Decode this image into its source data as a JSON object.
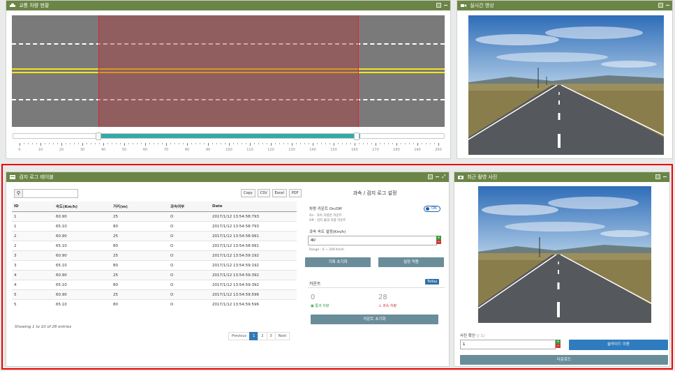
{
  "traffic_panel": {
    "title": "교통 차량 현황"
  },
  "range": {
    "ticks": [
      "0",
      "10",
      "20",
      "30",
      "40",
      "50",
      "60",
      "70",
      "80",
      "90",
      "100",
      "110",
      "120",
      "130",
      "140",
      "150",
      "160",
      "170",
      "180",
      "190",
      "200"
    ],
    "selected_from_index": 4,
    "selected_to_index": 16
  },
  "live_panel": {
    "title": "실시간 영상"
  },
  "log_panel": {
    "title": "검지 로그 테이블",
    "search_placeholder": "",
    "buttons": [
      "Copy",
      "CSV",
      "Excel",
      "PDF"
    ],
    "columns": [
      "ID",
      "속도(Km/h)",
      "거리(m)",
      "과속여부",
      "Date"
    ],
    "rows": [
      [
        "1",
        "60.90",
        "25",
        "O",
        "2017/1/12 13:54:58:793"
      ],
      [
        "1",
        "65.10",
        "80",
        "O",
        "2017/1/12 13:54:58:793"
      ],
      [
        "2",
        "60.90",
        "25",
        "O",
        "2017/1/12 13:54:58:991"
      ],
      [
        "2",
        "65.10",
        "80",
        "O",
        "2017/1/12 13:54:58:991"
      ],
      [
        "3",
        "60.90",
        "25",
        "O",
        "2017/1/12 13:54:59:192"
      ],
      [
        "3",
        "65.10",
        "80",
        "O",
        "2017/1/12 13:54:59:192"
      ],
      [
        "4",
        "60.90",
        "25",
        "O",
        "2017/1/12 13:54:59:392"
      ],
      [
        "4",
        "65.10",
        "80",
        "O",
        "2017/1/12 13:54:59:392"
      ],
      [
        "5",
        "60.90",
        "25",
        "O",
        "2017/1/12 13:54:59:596"
      ],
      [
        "5",
        "65.10",
        "80",
        "O",
        "2017/1/12 13:54:59:596"
      ]
    ],
    "info": "Showing 1 to 10 of 28 entries",
    "pagination": {
      "previous": "Previous",
      "pages": [
        "1",
        "2",
        "3"
      ],
      "next": "Next",
      "active": "1"
    }
  },
  "settings": {
    "title": "과속 / 검지 로그 설정",
    "counter_label": "차량 카운트 On/Off",
    "counter_desc1": "On : 과속 차량만 카운트",
    "counter_desc2": "Off : 검지 불과 차량 카운트",
    "toggle": "ON",
    "speed_label": "과속 속도 설정(Km/h)",
    "speed_value": "40",
    "range_note": "Range : 0 ~ 200 Km/h",
    "log_reset_button": "기록 초기화",
    "apply_button": "설정 적용",
    "count_title": "카운트",
    "today_badge": "Today",
    "normal_count": "0",
    "normal_label": "통과 차량",
    "speeding_count": "28",
    "speeding_label": "과속 차량",
    "count_reset_button": "카운트 초기화"
  },
  "photo_panel": {
    "title": "최근 촬영 사진",
    "photo_label": "사진 확인",
    "photo_total": "(/ 1)",
    "photo_value": "1",
    "slide_button": "슬라이드 이동",
    "download_button": "다운로드"
  },
  "colors": {
    "header": "#6b8547",
    "accent": "#33aaa6",
    "frame": "#ee0000",
    "button": "#6a8d9a"
  }
}
